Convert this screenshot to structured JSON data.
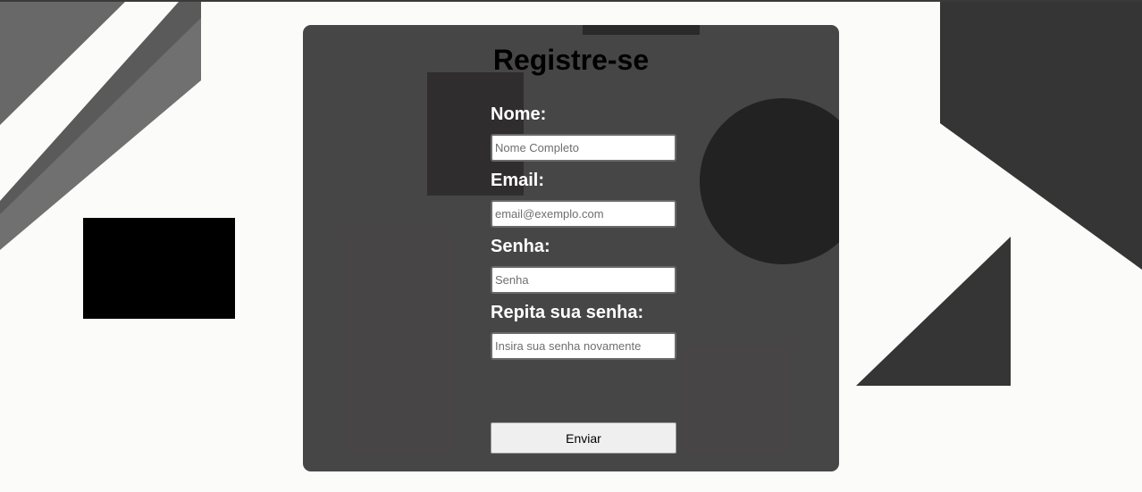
{
  "form": {
    "title": "Registre-se",
    "fields": [
      {
        "label": "Nome:",
        "placeholder": "Nome Completo",
        "value": ""
      },
      {
        "label": "Email:",
        "placeholder": "email@exemplo.com",
        "value": ""
      },
      {
        "label": "Senha:",
        "placeholder": "Senha",
        "value": ""
      },
      {
        "label": "Repita sua senha:",
        "placeholder": "Insira sua senha novamente",
        "value": ""
      }
    ],
    "submit_label": "Enviar"
  },
  "colors": {
    "page_background": "#fbfbfa",
    "panel_background": "#403e3f",
    "label_text": "#ffffff",
    "title_text": "#000000",
    "button_background": "#efefef"
  }
}
